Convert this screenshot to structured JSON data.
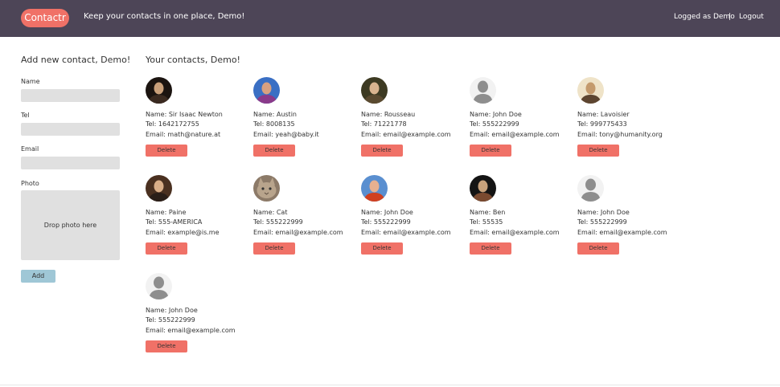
{
  "header": {
    "logo": "Contactr",
    "tagline": "Keep your contacts in one place, Demo!",
    "logged_as": "Logged as Demo",
    "separator": "|",
    "logout": "Logout"
  },
  "sidebar": {
    "title": "Add new contact, Demo!",
    "name_label": "Name",
    "tel_label": "Tel",
    "email_label": "Email",
    "photo_label": "Photo",
    "drop_text": "Drop photo here",
    "add_label": "Add"
  },
  "main": {
    "title": "Your contacts, Demo!",
    "name_prefix": "Name:",
    "tel_prefix": "Tel:",
    "email_prefix": "Email:",
    "delete_label": "Delete",
    "contacts": [
      {
        "name": "Sir Isaac Newton",
        "tel": "1642172755",
        "email": "math@nature.at",
        "photo": "portrait-dark"
      },
      {
        "name": "Austin",
        "tel": "8008135",
        "email": "yeah@baby.it",
        "photo": "portrait-colorful"
      },
      {
        "name": "Rousseau",
        "tel": "71221778",
        "email": "email@example.com",
        "photo": "portrait-olive"
      },
      {
        "name": "John Doe",
        "tel": "555222999",
        "email": "email@example.com",
        "photo": "placeholder"
      },
      {
        "name": "Lavoisier",
        "tel": "999775433",
        "email": "tony@humanity.org",
        "photo": "portrait-beige"
      },
      {
        "name": "Paine",
        "tel": "555-AMERICA",
        "email": "example@is.me",
        "photo": "portrait-brown"
      },
      {
        "name": "Cat",
        "tel": "555222999",
        "email": "email@example.com",
        "photo": "cat"
      },
      {
        "name": "John Doe",
        "tel": "555222999",
        "email": "email@example.com",
        "photo": "portrait-colorful2"
      },
      {
        "name": "Ben",
        "tel": "55535",
        "email": "email@example.com",
        "photo": "portrait-dark2"
      },
      {
        "name": "John Doe",
        "tel": "555222999",
        "email": "email@example.com",
        "photo": "placeholder"
      },
      {
        "name": "John Doe",
        "tel": "555222999",
        "email": "email@example.com",
        "photo": "placeholder"
      }
    ]
  },
  "colors": {
    "header_bg": "#4d4557",
    "accent": "#f07167",
    "add_button": "#9fc7d6",
    "input_bg": "#e0e0e0"
  }
}
